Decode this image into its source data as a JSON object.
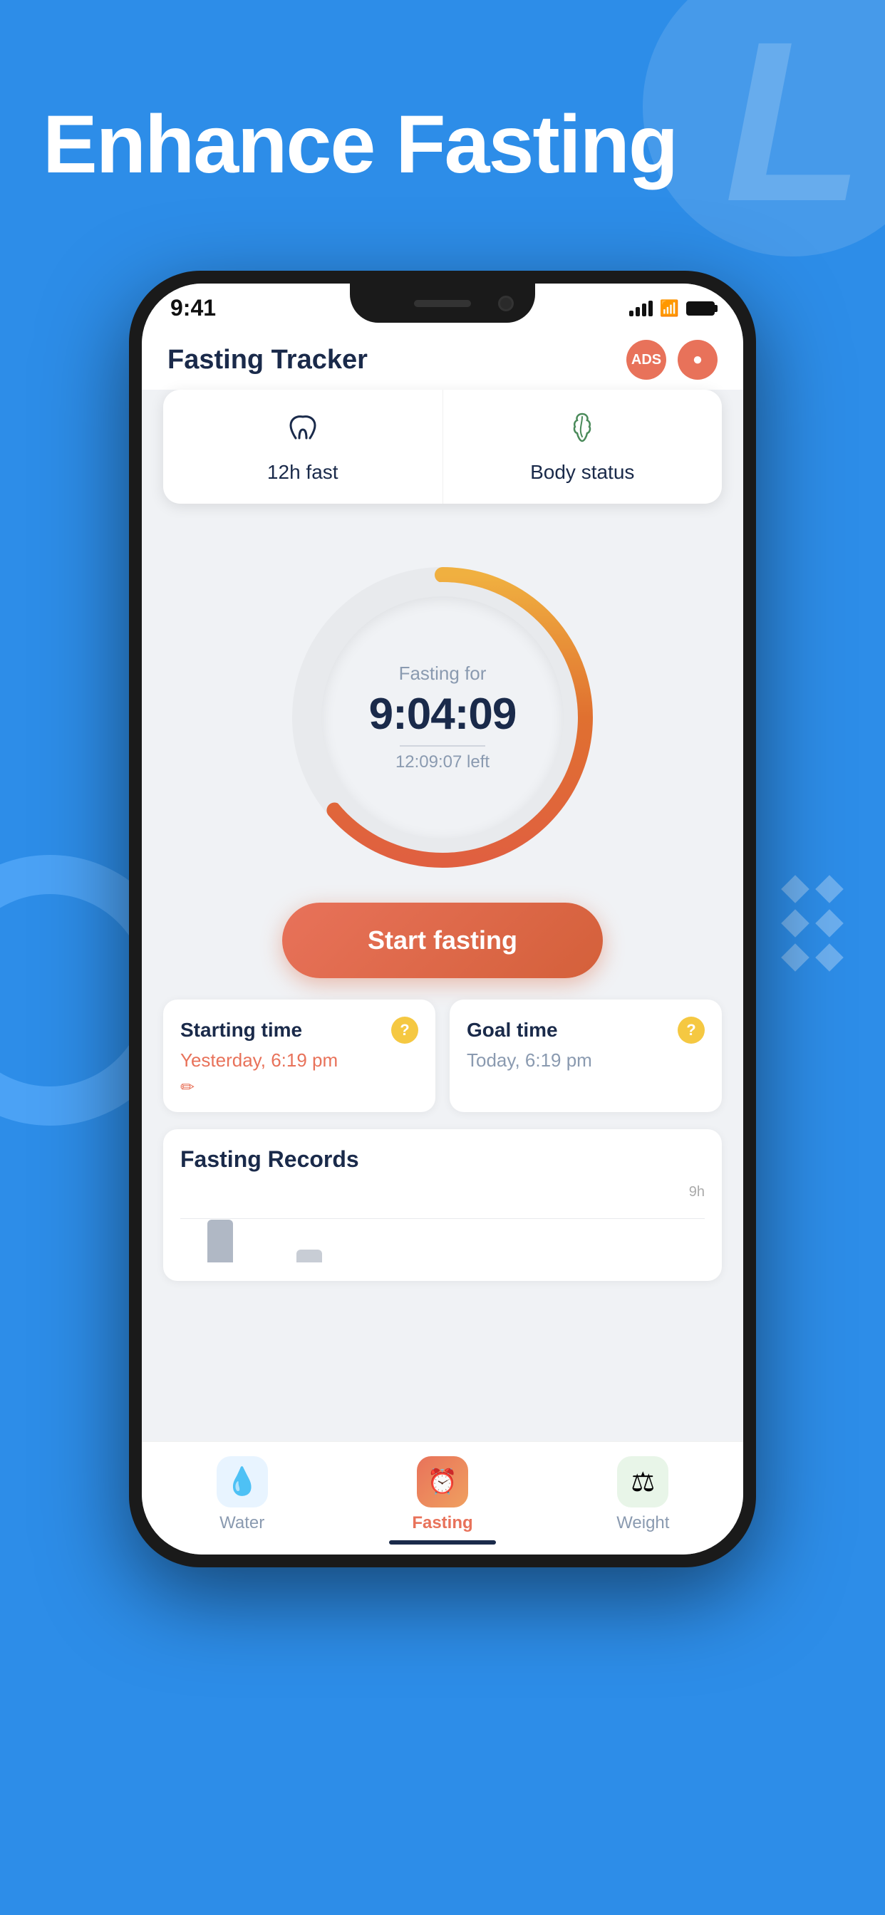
{
  "page": {
    "background_color": "#2d8de8",
    "title": "Enhance Fasting"
  },
  "status_bar": {
    "time": "9:41",
    "signal": "full",
    "wifi": true,
    "battery": "full"
  },
  "app_header": {
    "title": "Fasting Tracker",
    "ads_label": "ADS",
    "record_icon": "○"
  },
  "selector_tabs": [
    {
      "icon": "⌇",
      "label": "12h fast"
    },
    {
      "icon": "🌿",
      "label": "Body status"
    }
  ],
  "timer": {
    "label": "Fasting for",
    "time": "9:04:09",
    "left_label": "12:09:07 left"
  },
  "start_button": {
    "label": "Start fasting"
  },
  "time_cards": [
    {
      "title": "Starting time",
      "question": "?",
      "value": "Yesterday, 6:19 pm",
      "has_edit": true
    },
    {
      "title": "Goal time",
      "question": "?",
      "value": "Today, 6:19 pm",
      "has_edit": false
    }
  ],
  "records_section": {
    "title": "Fasting Records",
    "chart_max_label": "9h",
    "bars": [
      {
        "height": 60,
        "color": "#c0c5cc",
        "label": ""
      },
      {
        "height": 18,
        "color": "#c0c5cc",
        "label": ""
      },
      {
        "height": 0,
        "color": "transparent",
        "label": ""
      },
      {
        "height": 0,
        "color": "transparent",
        "label": ""
      },
      {
        "height": 0,
        "color": "transparent",
        "label": ""
      },
      {
        "height": 0,
        "color": "transparent",
        "label": ""
      }
    ]
  },
  "bottom_nav": [
    {
      "icon": "💧",
      "label": "Water",
      "active": false,
      "bg": "water"
    },
    {
      "icon": "⏰",
      "label": "Fasting",
      "active": true,
      "bg": "fasting"
    },
    {
      "icon": "⚖",
      "label": "Weight",
      "active": false,
      "bg": "weight"
    }
  ]
}
